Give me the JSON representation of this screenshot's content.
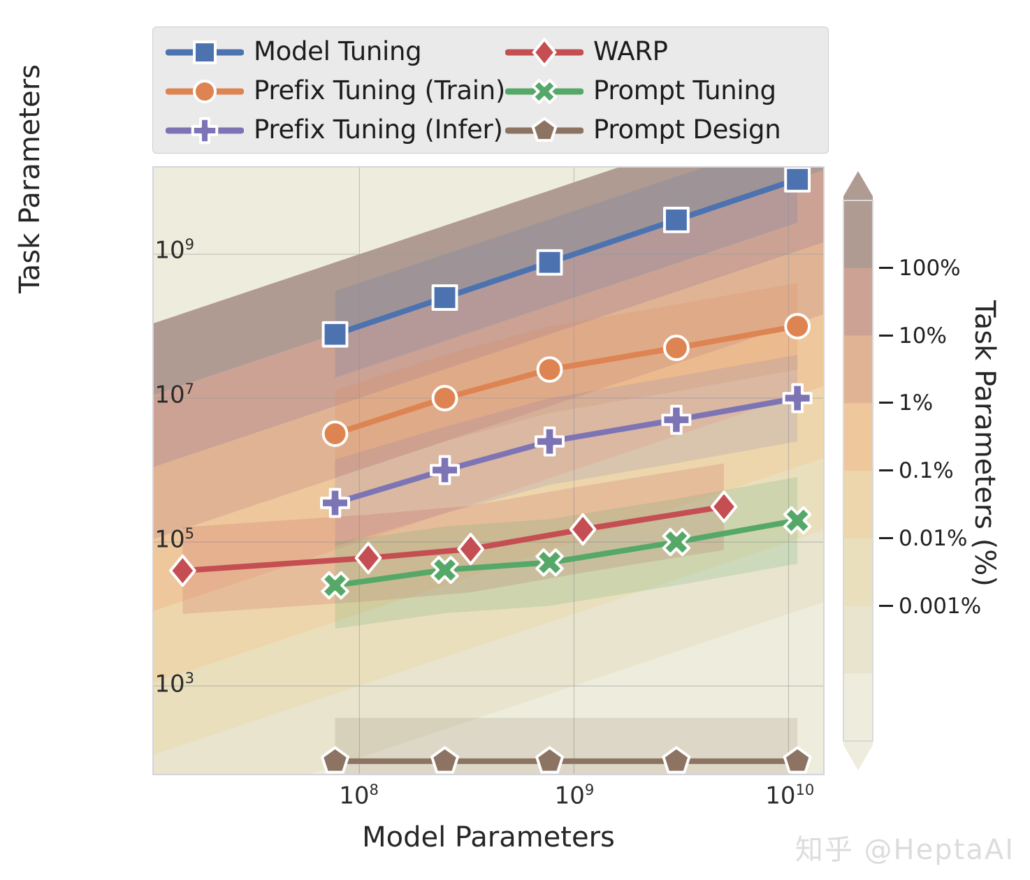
{
  "legend": {
    "entries": [
      {
        "label": "Model Tuning",
        "color": "#4C72B0",
        "marker": "square"
      },
      {
        "label": "WARP",
        "color": "#C44E52",
        "marker": "diamond"
      },
      {
        "label": "Prefix Tuning (Train)",
        "color": "#DD8452",
        "marker": "circle"
      },
      {
        "label": "Prompt Tuning",
        "color": "#55A868",
        "marker": "x"
      },
      {
        "label": "Prefix Tuning (Infer)",
        "color": "#7D74B5",
        "marker": "plus"
      },
      {
        "label": "Prompt Design",
        "color": "#8C7362",
        "marker": "pentagon"
      }
    ]
  },
  "axes": {
    "xlabel": "Model Parameters",
    "ylabel": "Task Parameters",
    "x_ticks": [
      {
        "base": "10",
        "exp": "8",
        "value": 100000000.0
      },
      {
        "base": "10",
        "exp": "9",
        "value": 1000000000.0
      },
      {
        "base": "10",
        "exp": "10",
        "value": 10000000000.0
      }
    ],
    "y_ticks": [
      {
        "base": "10",
        "exp": "3",
        "value": 1000.0
      },
      {
        "base": "10",
        "exp": "5",
        "value": 100000.0
      },
      {
        "base": "10",
        "exp": "7",
        "value": 10000000.0
      },
      {
        "base": "10",
        "exp": "9",
        "value": 1000000000.0
      }
    ],
    "xlim": [
      11000000.0,
      14500000000.0
    ],
    "ylim": [
      60,
      16000000000.0
    ],
    "xscale": "log",
    "yscale": "log",
    "grid": true
  },
  "colorbar": {
    "label": "Task Parameters (%)",
    "ticks": [
      "100%",
      "10%",
      "1%",
      "0.1%",
      "0.01%",
      "0.001%"
    ],
    "tick_values": [
      100,
      10,
      1,
      0.1,
      0.01,
      0.001
    ],
    "colors": [
      "#b09b93",
      "#cBA293",
      "#e0b394",
      "#eec79d",
      "#edd6ab",
      "#e9dfbc",
      "#e8e4cd",
      "#eeeddd"
    ],
    "extend": "both"
  },
  "watermark": "知乎 @HeptaAI",
  "chart_data": {
    "type": "line",
    "title": "",
    "xlabel": "Model Parameters",
    "ylabel": "Task Parameters",
    "xscale": "log",
    "yscale": "log",
    "xlim": [
      11000000.0,
      14500000000.0
    ],
    "ylim": [
      60,
      16000000000.0
    ],
    "grid": true,
    "legend_position": "above-axes",
    "background": "filled contours of task-parameter percentage (task/model params), log-log diagonal bands",
    "series": [
      {
        "name": "Model Tuning",
        "color": "#4C72B0",
        "marker": "square",
        "x": [
          77000000.0,
          250000000.0,
          770000000.0,
          3000000000.0,
          11000000000.0
        ],
        "y": [
          77000000.0,
          250000000.0,
          770000000.0,
          3000000000.0,
          11000000000.0
        ]
      },
      {
        "name": "Prefix Tuning (Train)",
        "color": "#DD8452",
        "marker": "circle",
        "x": [
          77000000.0,
          250000000.0,
          770000000.0,
          3000000000.0,
          11000000000.0
        ],
        "y": [
          3200000.0,
          10000000.0,
          25000000.0,
          50000000.0,
          100000000.0
        ]
      },
      {
        "name": "Prefix Tuning (Infer)",
        "color": "#7D74B5",
        "marker": "plus",
        "x": [
          77000000.0,
          250000000.0,
          770000000.0,
          3000000000.0,
          11000000000.0
        ],
        "y": [
          350000.0,
          1000000.0,
          2500000.0,
          5000000.0,
          10000000.0
        ]
      },
      {
        "name": "WARP",
        "color": "#C44E52",
        "marker": "diamond",
        "x": [
          15000000.0,
          110000000.0,
          330000000.0,
          1100000000.0,
          5000000000.0
        ],
        "y": [
          40000.0,
          60000.0,
          80000.0,
          150000.0,
          310000.0
        ]
      },
      {
        "name": "Prompt Tuning",
        "color": "#55A868",
        "marker": "x",
        "x": [
          77000000.0,
          250000000.0,
          770000000.0,
          3000000000.0,
          11000000000.0
        ],
        "y": [
          25000.0,
          41000.0,
          52000.0,
          100000.0,
          200000.0
        ]
      },
      {
        "name": "Prompt Design",
        "color": "#8C7362",
        "marker": "pentagon",
        "x": [
          77000000.0,
          250000000.0,
          770000000.0,
          3000000000.0,
          11000000000.0
        ],
        "y": [
          90,
          90,
          90,
          90,
          90
        ]
      }
    ],
    "bands": [
      {
        "name": "Model Tuning band",
        "color": "#4C72B0",
        "opacity": 0.18
      },
      {
        "name": "Prefix Tuning (Train) band",
        "color": "#DD8452",
        "opacity": 0.18
      },
      {
        "name": "Prefix Tuning (Infer) band",
        "color": "#7D74B5",
        "opacity": 0.18
      },
      {
        "name": "WARP band",
        "color": "#C44E52",
        "opacity": 0.18
      },
      {
        "name": "Prompt Tuning band",
        "color": "#55A868",
        "opacity": 0.18
      },
      {
        "name": "Prompt Design band",
        "color": "#8C7362",
        "opacity": 0.18
      }
    ]
  }
}
